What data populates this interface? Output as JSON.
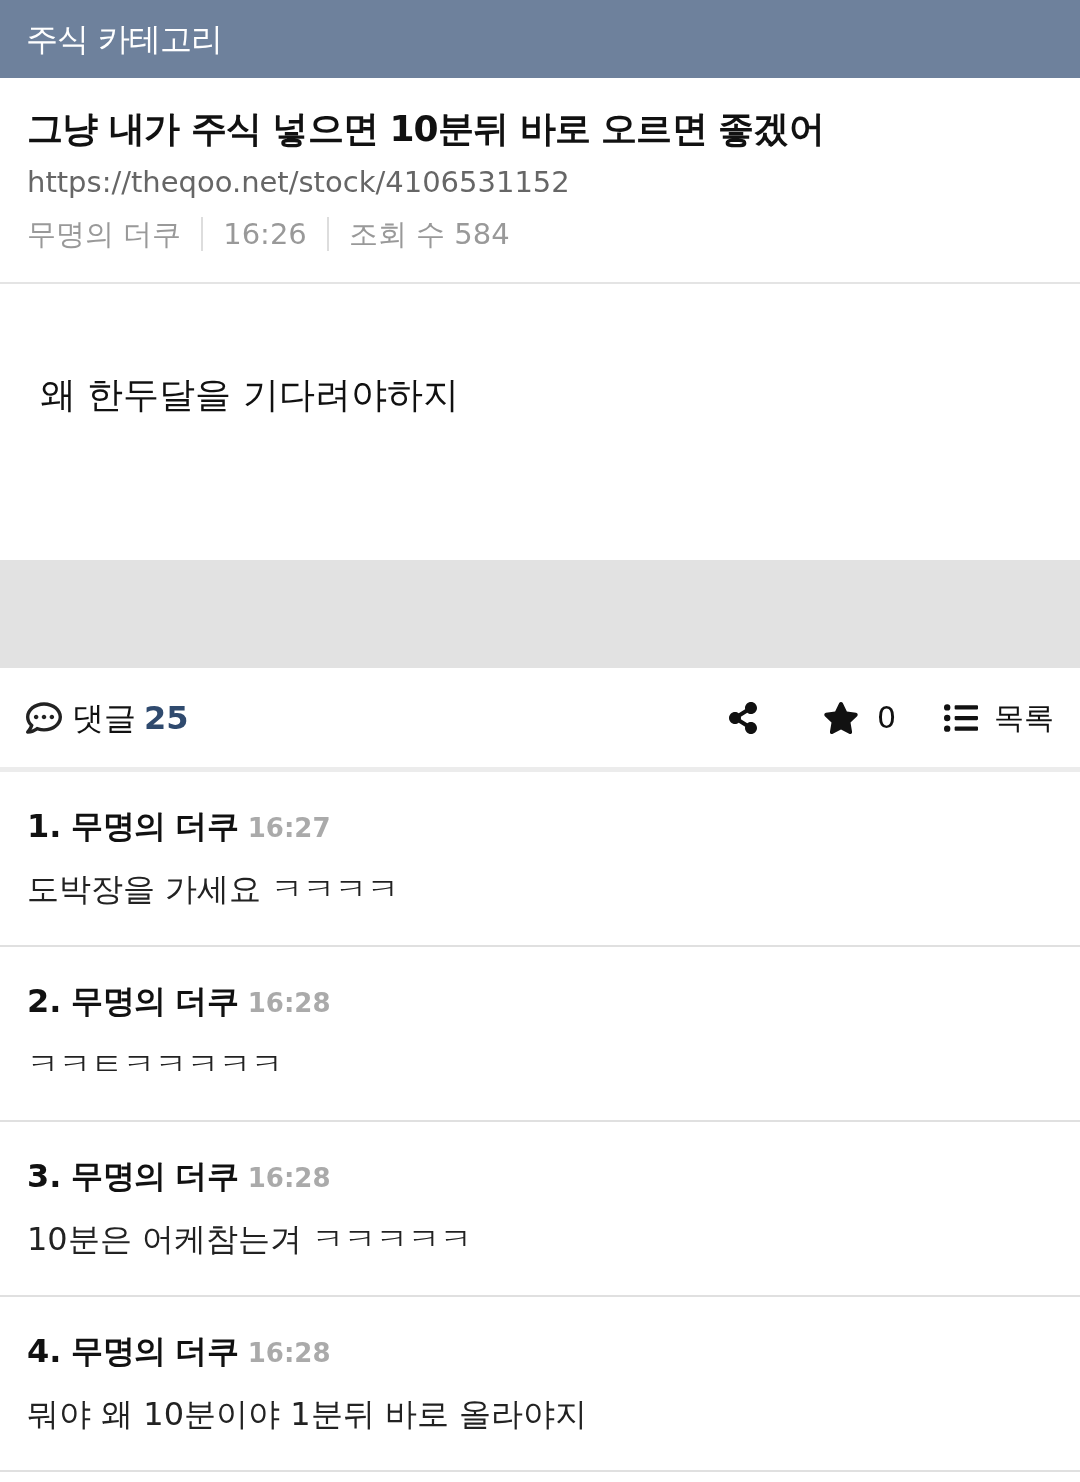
{
  "category_bar": {
    "title": "주식 카테고리"
  },
  "post": {
    "title": "그냥 내가 주식 넣으면 10분뒤 바로 오르면 좋겠어",
    "url": "https://theqoo.net/stock/4106531152",
    "author": "무명의 더쿠",
    "time": "16:26",
    "views": "조회 수 584",
    "body": "왜 한두달을 기다려야하지"
  },
  "toolbar": {
    "comments_label": "댓글",
    "comments_count": "25",
    "star_count": "0",
    "list_label": "목록"
  },
  "comments": [
    {
      "number": "1.",
      "author": "무명의 더쿠",
      "time": "16:27",
      "text": "도박장을 가세요 ㅋㅋㅋㅋ"
    },
    {
      "number": "2.",
      "author": "무명의 더쿠",
      "time": "16:28",
      "text": "ㅋㅋㅌㅋㅋㅋㅋㅋ"
    },
    {
      "number": "3.",
      "author": "무명의 더쿠",
      "time": "16:28",
      "text": "10분은 어케참는겨 ㅋㅋㅋㅋㅋ"
    },
    {
      "number": "4.",
      "author": "무명의 더쿠",
      "time": "16:28",
      "text": "뭐야 왜 10분이야 1분뒤 바로 올라야지"
    }
  ]
}
